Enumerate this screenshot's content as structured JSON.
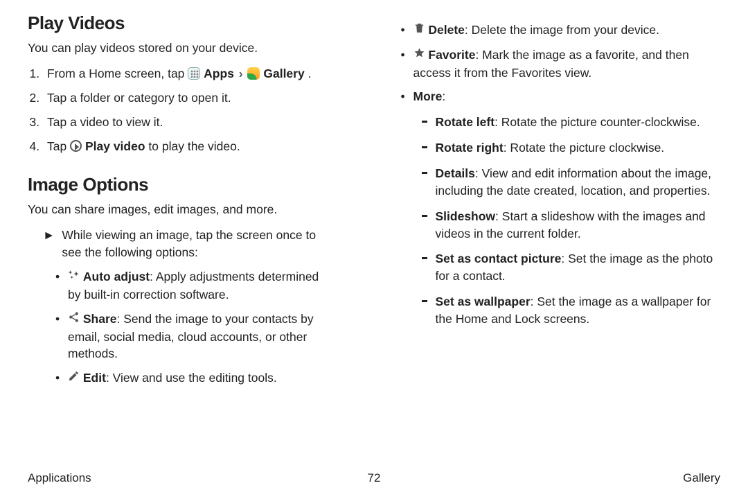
{
  "h1_play": "Play Videos",
  "play_intro": "You can play videos stored on your device.",
  "steps": {
    "s1a": "From a Home screen, tap ",
    "s1_apps": "Apps",
    "s1_gallery": "Gallery",
    "s2": "Tap a folder or category to open it.",
    "s3": "Tap a video to view it.",
    "s4a": "Tap ",
    "s4_play": "Play video",
    "s4b": " to play the video."
  },
  "h1_img": "Image Options",
  "img_intro": "You can share images, edit images, and more.",
  "arrow_text": "While viewing an image, tap the screen once to see the following options:",
  "opts": {
    "auto_t": "Auto adjust",
    "auto_d": ": Apply adjustments determined by built-in correction software.",
    "share_t": "Share",
    "share_d": ": Send the image to your contacts by email, social media, cloud accounts, or other methods.",
    "edit_t": "Edit",
    "edit_d": ": View and use the editing tools.",
    "del_t": "Delete",
    "del_d": ": Delete the image from your device.",
    "fav_t": "Favorite",
    "fav_d": ": Mark the image as a favorite, and then access it from the Favorites view.",
    "more_t": "More",
    "more_colon": ":",
    "rl_t": "Rotate left",
    "rl_d": ": Rotate the picture counter‑clockwise.",
    "rr_t": "Rotate right",
    "rr_d": ": Rotate the picture clockwise.",
    "det_t": "Details",
    "det_d": ": View and edit information about the image, including the date created, location, and properties.",
    "ss_t": "Slideshow",
    "ss_d": ": Start a slideshow with the images and videos in the current folder.",
    "cp_t": "Set as contact picture",
    "cp_d": ": Set the image as the photo for a contact.",
    "wp_t": "Set as wallpaper",
    "wp_d": ": Set the image as a wallpaper for the Home and Lock screens."
  },
  "footer": {
    "left": "Applications",
    "page": "72",
    "right": "Gallery"
  }
}
